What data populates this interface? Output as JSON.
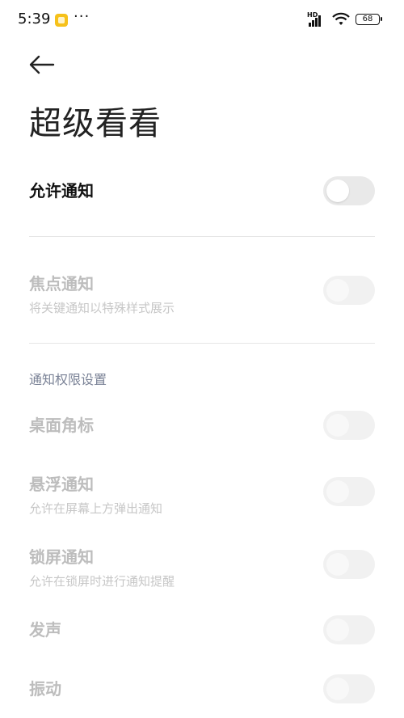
{
  "status_bar": {
    "time": "5:39",
    "more": "···",
    "network": "HD",
    "battery": "68"
  },
  "page": {
    "title": "超级看看"
  },
  "allow_notifications": {
    "label": "允许通知"
  },
  "focus_notifications": {
    "label": "焦点通知",
    "description": "将关键通知以特殊样式展示"
  },
  "permissions_section": {
    "header": "通知权限设置",
    "items": [
      {
        "label": "桌面角标"
      },
      {
        "label": "悬浮通知",
        "description": "允许在屏幕上方弹出通知"
      },
      {
        "label": "锁屏通知",
        "description": "允许在锁屏时进行通知提醒"
      },
      {
        "label": "发声"
      },
      {
        "label": "振动"
      }
    ]
  }
}
